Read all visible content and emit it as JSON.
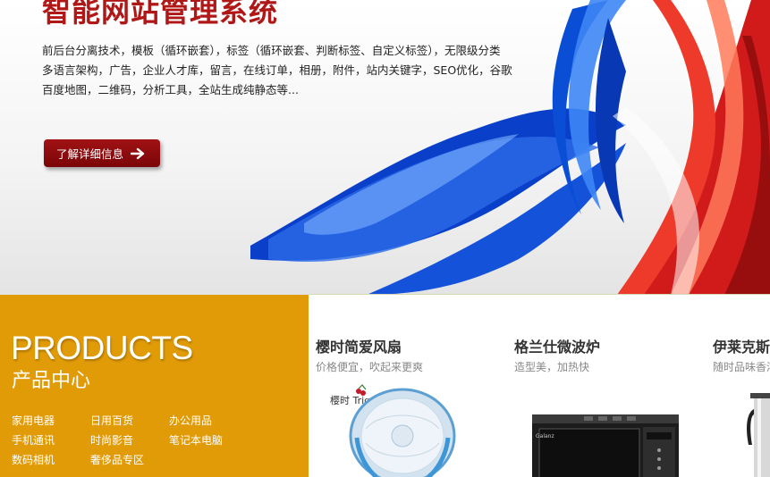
{
  "banner": {
    "title": "智能网站管理系统",
    "desc_lines": [
      "前后台分离技术，模板（循环嵌套），标签（循环嵌套、判断标签、自定义标签），无限级分类",
      "多语言架构，广告，企业人才库，留言，在线订单，相册，附件，站内关键字，SEO优化，谷歌",
      "百度地图，二维码，分析工具，全站生成纯静态等..."
    ],
    "button_label": "了解详细信息",
    "accent_color": "#b01717",
    "button_color": "#8b0b0e"
  },
  "products": {
    "title_en": "PRODUCTS",
    "title_cn": "产品中心",
    "bg_color": "#e19b07",
    "categories": [
      [
        "家用电器",
        "日用百货",
        "办公用品"
      ],
      [
        "手机通讯",
        "时尚影音",
        "笔记本电脑"
      ],
      [
        "数码相机",
        "奢侈品专区"
      ]
    ]
  },
  "items": [
    {
      "name": "樱时简爱风扇",
      "desc": "价格便宜，吹起来更爽",
      "brand_text": "樱时 TrigS"
    },
    {
      "name": "格兰仕微波炉",
      "desc": "造型美，加热快",
      "brand_text": "Galanz"
    },
    {
      "name": "伊莱克斯",
      "desc": "随时品味香浓"
    }
  ]
}
